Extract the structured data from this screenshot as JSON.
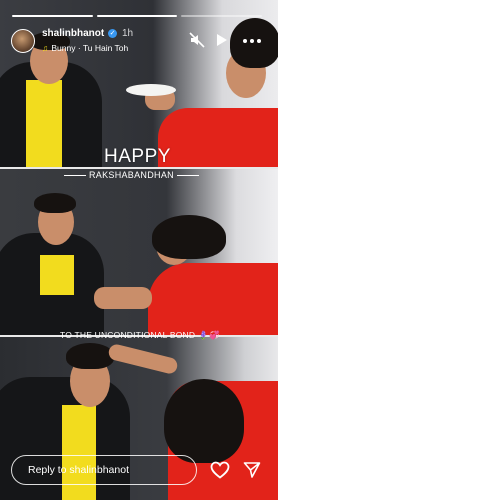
{
  "story": {
    "progress": {
      "segments": 3,
      "completed": 2
    },
    "header": {
      "username": "shalinbhanot",
      "verified": true,
      "time": "1h",
      "music": "Bunny · Tu Hain Toh"
    },
    "controls": {
      "mute_icon": "speaker-muted-icon",
      "play_icon": "play-icon",
      "more_icon": "more-options-icon"
    },
    "overlays": {
      "happy": "HAPPY",
      "rakshabandhan": "RAKSHABANDHAN",
      "bond": "TO THE UNCONDITIONAL BOND",
      "bond_emoji": "🪻💞"
    },
    "reply": {
      "placeholder": "Reply to shalinbhanot"
    },
    "actions": {
      "like_icon": "heart-icon",
      "share_icon": "send-icon"
    },
    "colors": {
      "shirt_yellow": "#f2dc1e",
      "dress_red": "#e2231a",
      "verified_blue": "#3897f0"
    }
  }
}
